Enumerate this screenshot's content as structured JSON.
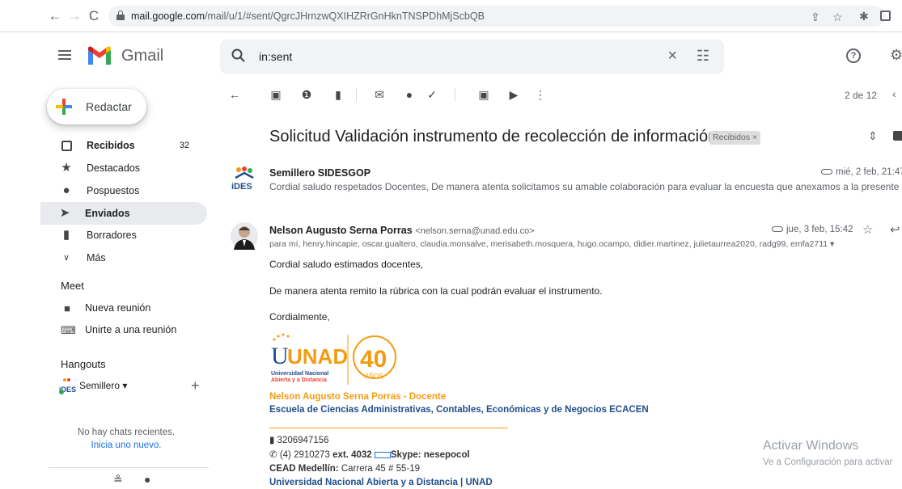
{
  "browser": {
    "url_host": "mail.google.com",
    "url_path": "/mail/u/1/#sent/QgrcJHrnzwQXIHZRrGnHknTNSPDhMjScbQB"
  },
  "app": {
    "name": "Gmail",
    "search_value": "in:sent"
  },
  "compose": {
    "label": "Redactar"
  },
  "sidebar": {
    "items": [
      {
        "label": "Recibidos",
        "count": "32",
        "icon": "inbox-icon"
      },
      {
        "label": "Destacados",
        "icon": "star-icon"
      },
      {
        "label": "Pospuestos",
        "icon": "clock-icon"
      },
      {
        "label": "Enviados",
        "icon": "send-icon",
        "active": true
      },
      {
        "label": "Borradores",
        "icon": "draft-icon"
      },
      {
        "label": "Más",
        "icon": "chevron-down-icon"
      }
    ],
    "meet": {
      "title": "Meet",
      "items": [
        {
          "label": "Nueva reunión",
          "icon": "video-icon"
        },
        {
          "label": "Unirte a una reunión",
          "icon": "keyboard-icon"
        }
      ]
    },
    "hangouts": {
      "title": "Hangouts",
      "user": "Semillero",
      "no_chats": "No hay chats recientes.",
      "start_link": "Inicia uno nuevo."
    }
  },
  "toolbar": {
    "pager": "2 de 12"
  },
  "thread": {
    "subject": "Solicitud Validación instrumento de recolección de información",
    "label": "Recibidos ×",
    "messages": [
      {
        "sender": "Semillero SIDESGOP",
        "date": "mié, 2 feb, 21:47",
        "snippet": "Cordial saludo respetados Docentes, De manera atenta solicitamos su amable colaboración para evaluar la encuesta que anexamos a la presente comu"
      },
      {
        "sender": "Nelson Augusto Serna Porras",
        "email": "<nelson.serna@unad.edu.co>",
        "date": "jue, 3 feb, 15:42",
        "recipients": "para mí, henry.hincapie, oscar.gualtero, claudia.monsalve, merisabeth.mosquera, hugo.ocampo, didier.martinez, julietaurrea2020, radg99, emfa2711 ▾",
        "body": [
          "Cordial saludo estimados docentes,",
          "De manera atenta remito la rúbrica con la cual podrán evaluar el instrumento.",
          "Cordialmente,"
        ]
      }
    ]
  },
  "signature": {
    "logo_text": "UNAD",
    "logo_sub1": "Universidad Nacional",
    "logo_sub2": "Abierta y a Distancia",
    "anniv": "40",
    "anniv_word": "AÑOS",
    "name": "Nelson Augusto Serna Porras - Docente",
    "school": "Escuela de Ciencias Administrativas, Contables, Económicas y de Negocios ECACEN",
    "phone": "3206947156",
    "tel_prefix": "✆ (4) 2910273",
    "ext": "ext. 4032",
    "skype": "Skype: nesepocol",
    "cead_label": "CEAD Medellín:",
    "cead_address": "Carrera 45 # 55-19",
    "university": "Universidad Nacional Abierta y a Distancia | UNAD"
  },
  "windows": {
    "activate": "Activar Windows",
    "activate_sub": "Ve a Configuración para activar"
  },
  "colors": {
    "accent_orange": "#f39c12",
    "unad_blue": "#1f4e8c",
    "gmail_red": "#ea4335"
  }
}
